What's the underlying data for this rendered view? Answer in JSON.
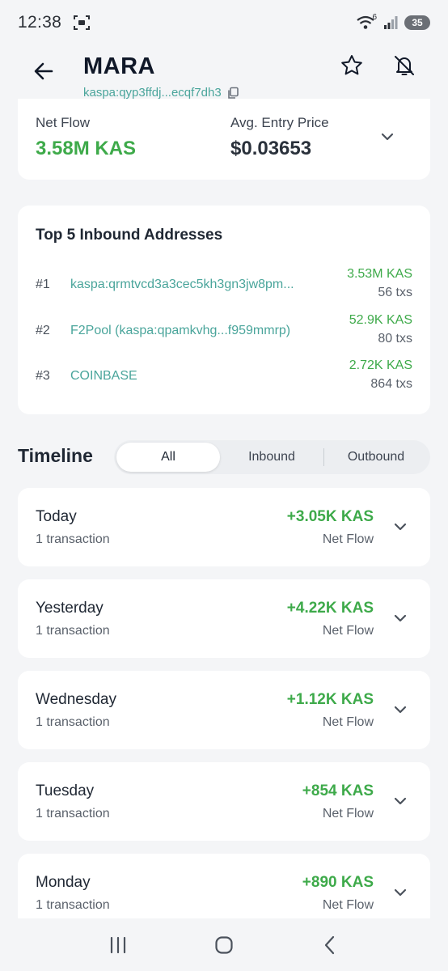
{
  "status": {
    "time": "12:38",
    "wifi_badge": "6",
    "battery": "35"
  },
  "header": {
    "title": "MARA",
    "address": "kaspa:qyp3ffdj...ecqf7dh3"
  },
  "summary": {
    "net_flow_label": "Net Flow",
    "net_flow_value": "3.58M KAS",
    "entry_label": "Avg. Entry Price",
    "entry_value": "$0.03653"
  },
  "inbound": {
    "title": "Top 5 Inbound Addresses",
    "rows": [
      {
        "rank": "#1",
        "address": "kaspa:qrmtvcd3a3cec5kh3gn3jw8pm...",
        "amount": "3.53M KAS",
        "txs": "56 txs"
      },
      {
        "rank": "#2",
        "address": "F2Pool (kaspa:qpamkvhg...f959mmrp)",
        "amount": "52.9K KAS",
        "txs": "80 txs"
      },
      {
        "rank": "#3",
        "address": "COINBASE",
        "amount": "2.72K KAS",
        "txs": "864 txs"
      }
    ]
  },
  "timeline": {
    "title": "Timeline",
    "tabs": [
      "All",
      "Inbound",
      "Outbound"
    ],
    "days": [
      {
        "name": "Today",
        "count": "1 transaction",
        "amount": "+3.05K KAS",
        "sub": "Net Flow"
      },
      {
        "name": "Yesterday",
        "count": "1 transaction",
        "amount": "+4.22K KAS",
        "sub": "Net Flow"
      },
      {
        "name": "Wednesday",
        "count": "1 transaction",
        "amount": "+1.12K KAS",
        "sub": "Net Flow"
      },
      {
        "name": "Tuesday",
        "count": "1 transaction",
        "amount": "+854 KAS",
        "sub": "Net Flow"
      },
      {
        "name": "Monday",
        "count": "1 transaction",
        "amount": "+890 KAS",
        "sub": "Net Flow"
      }
    ]
  },
  "colors": {
    "accent_green": "#3eaa4a",
    "link_teal": "#4aa59b",
    "background": "#f4f5f7"
  }
}
